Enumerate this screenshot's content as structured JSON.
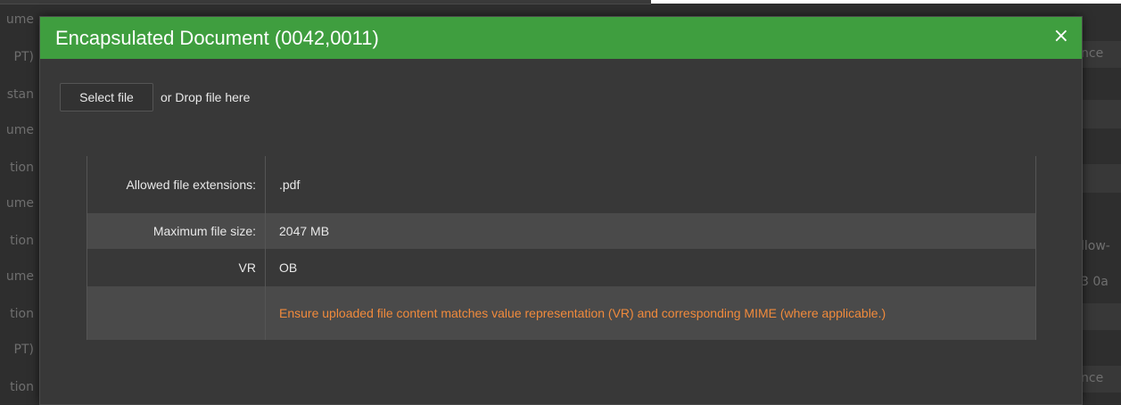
{
  "background": {
    "left_labels": [
      "ume",
      "PT)",
      "stan",
      "ume",
      "tion",
      "ume",
      "tion",
      "ume",
      "tion",
      "PT)",
      "tion"
    ],
    "right_labels": [
      "nce",
      "llow-",
      "3 0a",
      "nce"
    ]
  },
  "dialog": {
    "title": "Encapsulated Document (0042,0011)",
    "close_glyph": "×",
    "header_color": "#3f9e3f",
    "select_file_label": "Select file",
    "drop_text": "or Drop file here",
    "rows": [
      {
        "label": "Allowed file extensions:",
        "value": ".pdf"
      },
      {
        "label": "Maximum file size:",
        "value": "2047 MB"
      },
      {
        "label": "VR",
        "value": "OB"
      },
      {
        "label": "",
        "value": "Ensure uploaded file content matches value representation (VR) and corresponding MIME (where applicable.)"
      }
    ],
    "warning_color": "#f08a3c"
  }
}
